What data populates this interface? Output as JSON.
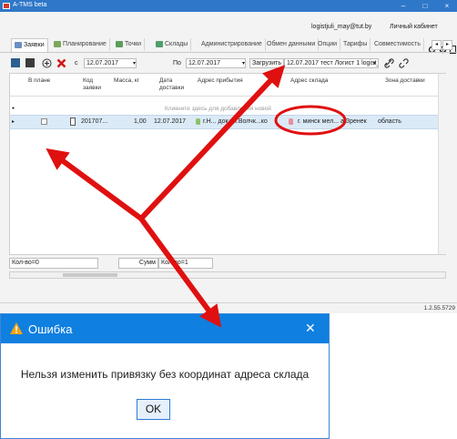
{
  "app": {
    "title": "A-TMS beta",
    "window_buttons": {
      "minimize": "–",
      "maximize": "□",
      "close": "×"
    },
    "user_email": "logistjuli_may@tut.by",
    "cabinet_label": "Личный кабинет",
    "tabs": [
      "Заявки",
      "Планирование",
      "Точки",
      "Склады",
      "Администрирование",
      "Обмен данными",
      "Опции",
      "Тарифы",
      "Совместимость"
    ],
    "toolbar": {
      "from_label": "с",
      "from_date": "12.07.2017",
      "to_label": "По",
      "to_date": "12.07.2017",
      "load_label": "Загрузить",
      "load_value": "12.07.2017 тест Логист 1 logist_ju"
    },
    "grid": {
      "headers": [
        "В плане",
        "Код заявки",
        "Масса, кг",
        "Дата доставки",
        "Адрес прибытия",
        "Адрес склада",
        "Зона доставки"
      ],
      "hint": "Кликните здесь для добавления новой",
      "row": {
        "code": "201707...",
        "mass": "1,00",
        "date": "12.07.2017",
        "arrival": "г.Н...  док ул.Волчк...ко",
        "warehouse": "г. минск мел... а Зренек",
        "zone": "область"
      }
    },
    "footer": {
      "count_left": "Кол-во=0",
      "sum_label": "Сумм",
      "count_right": "Кол-во=1"
    },
    "version": "1.2.55.5729"
  },
  "dialog": {
    "title": "Ошибка",
    "message": "Нельзя изменить привязку без координат адреса склада",
    "ok_label": "OK",
    "close_glyph": "✕"
  },
  "colors": {
    "titlebar": "#2f77c8",
    "dialog_title": "#0f7fe0",
    "arrow": "#e01010",
    "selected_row": "#dbeaf7"
  }
}
